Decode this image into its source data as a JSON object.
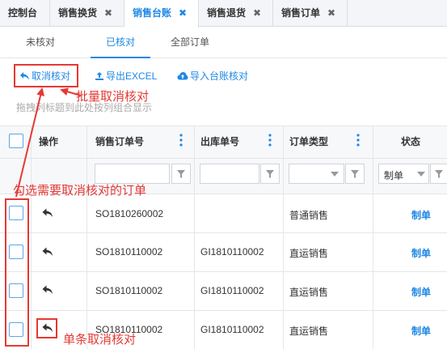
{
  "top_tabs": [
    {
      "label": "控制台",
      "closable": false
    },
    {
      "label": "销售换货",
      "closable": true
    },
    {
      "label": "销售台账",
      "closable": true,
      "active": true
    },
    {
      "label": "销售退货",
      "closable": true
    },
    {
      "label": "销售订单",
      "closable": true
    }
  ],
  "close_glyph": "✖",
  "sub_tabs": [
    "未核对",
    "已核对",
    "全部订单"
  ],
  "toolbar": {
    "cancel_check": "取消核对",
    "export_excel": "导出EXCEL",
    "import_ledger": "导入台账核对"
  },
  "group_hint": "拖拽列标题到此处按列组合显示",
  "columns": {
    "action": "操作",
    "order_no": "销售订单号",
    "outbound_no": "出库单号",
    "order_type": "订单类型",
    "status": "状态"
  },
  "filters": {
    "status_value": "制单"
  },
  "rows": [
    {
      "order_no": "SO1810260002",
      "outbound_no": "",
      "order_type": "普通销售",
      "status": "制单"
    },
    {
      "order_no": "SO1810110002",
      "outbound_no": "GI1810110002",
      "order_type": "直运销售",
      "status": "制单"
    },
    {
      "order_no": "SO1810110002",
      "outbound_no": "GI1810110002",
      "order_type": "直运销售",
      "status": "制单"
    },
    {
      "order_no": "SO1810110002",
      "outbound_no": "GI1810110002",
      "order_type": "直运销售",
      "status": "制单"
    }
  ],
  "annotations": {
    "batch": "批量取消核对",
    "select": "勾选需要取消核对的订单",
    "single": "单条取消核对"
  },
  "colors": {
    "accent": "#1e88e5",
    "annotation": "#e53935"
  }
}
